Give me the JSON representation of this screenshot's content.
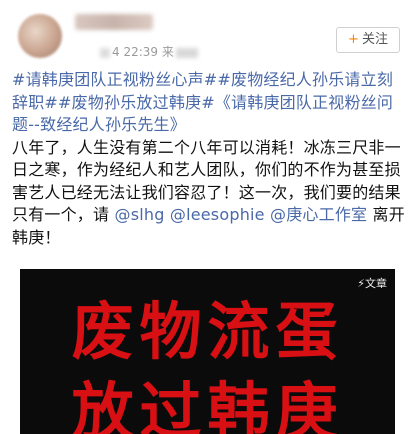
{
  "header": {
    "time": "4 22:39",
    "source_prefix": "来",
    "follow_label": "关注",
    "follow_icon": "plus-icon"
  },
  "post": {
    "tags": [
      "#请韩庚团队正视粉丝心声#",
      "#废物经纪人孙乐请立刻辞职#",
      "#废物孙乐放过韩庚#",
      "《请韩庚团队正视粉丝问题--致经纪人孙乐先生》"
    ],
    "body_1": "八年了，人生没有第二个八年可以消耗！冰冻三尺非一日之寒，作为经纪人和艺人团队，你们的不作为甚至损害艺人已经无法让我们容忍了！这一次，我们要的结果只有一个，请 ",
    "mention_1": "@slhg",
    "mention_2": "@leesophie",
    "mention_3": "@庚心工作室",
    "body_end": " 离开韩庚！"
  },
  "image": {
    "badge": "文章",
    "line_1": "废物流蛋",
    "line_2": "放过韩庚",
    "text_color": "#d80f13",
    "bg_color": "#0b0b0b"
  }
}
